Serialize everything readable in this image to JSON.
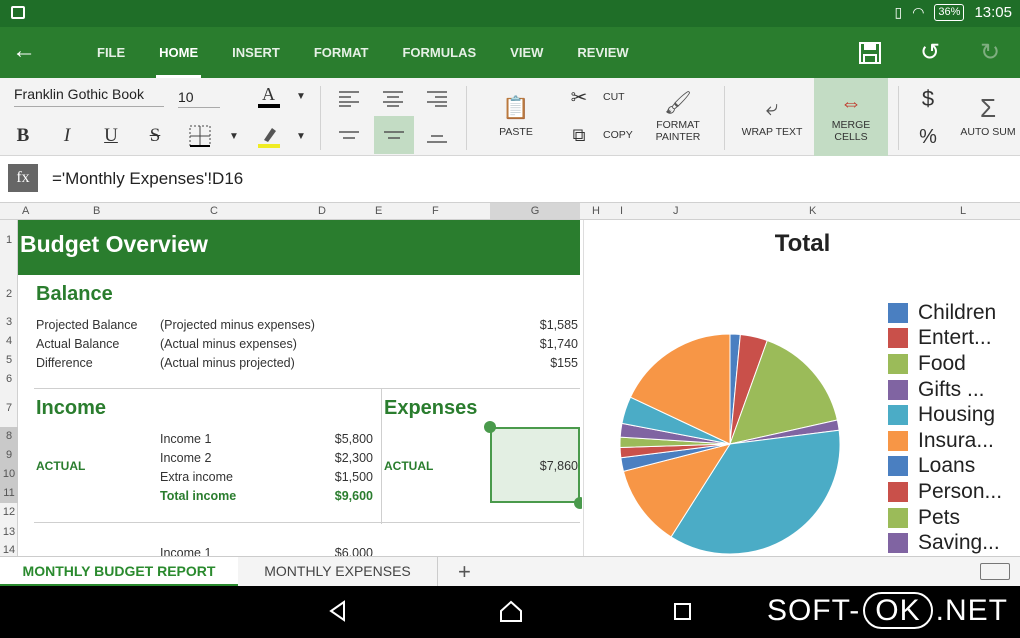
{
  "status": {
    "battery": "36%",
    "time": "13:05"
  },
  "menu": {
    "tabs": [
      "FILE",
      "HOME",
      "INSERT",
      "FORMAT",
      "FORMULAS",
      "VIEW",
      "REVIEW"
    ],
    "active_tab": "HOME"
  },
  "ribbon": {
    "font_name": "Franklin Gothic Book",
    "font_size": "10",
    "bold": "B",
    "italic": "I",
    "underline": "U",
    "strike": "S",
    "paste": "PASTE",
    "cut": "CUT",
    "copy": "COPY",
    "format_painter_1": "FORMAT",
    "format_painter_2": "PAINTER",
    "wrap_text": "WRAP TEXT",
    "merge_1": "MERGE",
    "merge_2": "CELLS",
    "dollar": "$",
    "percent": "%",
    "auto_sum": "AUTO SUM",
    "sigma": "Σ"
  },
  "formula_bar": {
    "fx": "fx",
    "formula": "='Monthly Expenses'!D16"
  },
  "columns": [
    "A",
    "B",
    "C",
    "D",
    "E",
    "F",
    "G",
    "H",
    "I",
    "J",
    "K",
    "L"
  ],
  "rows": [
    "1",
    "2",
    "3",
    "4",
    "5",
    "6",
    "7",
    "8",
    "9",
    "10",
    "11",
    "12",
    "13",
    "14"
  ],
  "sheet": {
    "title": "Budget Overview",
    "balance": {
      "heading": "Balance",
      "rows": [
        {
          "label": "Projected Balance",
          "desc": "(Projected  minus expenses)",
          "value": "$1,585"
        },
        {
          "label": "Actual Balance",
          "desc": "(Actual  minus expenses)",
          "value": "$1,740"
        },
        {
          "label": "Difference",
          "desc": "(Actual minus projected)",
          "value": "$155"
        }
      ]
    },
    "income": {
      "heading": "Income",
      "actual": "ACTUAL",
      "rows": [
        {
          "label": "Income 1",
          "value": "$5,800"
        },
        {
          "label": "Income 2",
          "value": "$2,300"
        },
        {
          "label": "Extra income",
          "value": "$1,500"
        },
        {
          "label": "Total income",
          "value": "$9,600"
        }
      ],
      "next_label": "Income 1",
      "next_value": "$6,000"
    },
    "expenses": {
      "heading": "Expenses",
      "actual": "ACTUAL",
      "value": "$7,860"
    }
  },
  "chart_data": {
    "type": "pie",
    "title": "Total",
    "legend_position": "right",
    "labels": [
      "Children",
      "Entert...",
      "Food",
      "Gifts ...",
      "Housing",
      "Insura...",
      "Loans",
      "Person...",
      "Pets",
      "Saving..."
    ],
    "colors": [
      "#4a7fc1",
      "#c9504a",
      "#9bbb59",
      "#8064a2",
      "#4bacc6",
      "#f79646",
      "#4a7fc1",
      "#c9504a",
      "#9bbb59",
      "#8064a2"
    ],
    "slices": [
      {
        "label": "Children",
        "value": 1.5,
        "color": "#4a7fc1"
      },
      {
        "label": "Entert...",
        "value": 4,
        "color": "#c9504a"
      },
      {
        "label": "Food",
        "value": 16,
        "color": "#9bbb59"
      },
      {
        "label": "Gifts ...",
        "value": 1.5,
        "color": "#8064a2"
      },
      {
        "label": "Housing",
        "value": 36,
        "color": "#4bacc6"
      },
      {
        "label": "Insura...",
        "value": 12,
        "color": "#f79646"
      },
      {
        "label": "Loans",
        "value": 2,
        "color": "#4a7fc1"
      },
      {
        "label": "Person...",
        "value": 1.5,
        "color": "#c9504a"
      },
      {
        "label": "Pets",
        "value": 1.5,
        "color": "#9bbb59"
      },
      {
        "label": "Saving...",
        "value": 2,
        "color": "#8064a2"
      },
      {
        "label": "",
        "value": 4,
        "color": "#4bacc6"
      },
      {
        "label": "",
        "value": 18,
        "color": "#f79646"
      }
    ]
  },
  "sheet_tabs": {
    "active": "MONTHLY BUDGET REPORT",
    "other": "MONTHLY EXPENSES",
    "add": "+"
  },
  "watermark": {
    "pre": "SOFT-",
    "ok": "OK",
    "post": ".NET"
  }
}
